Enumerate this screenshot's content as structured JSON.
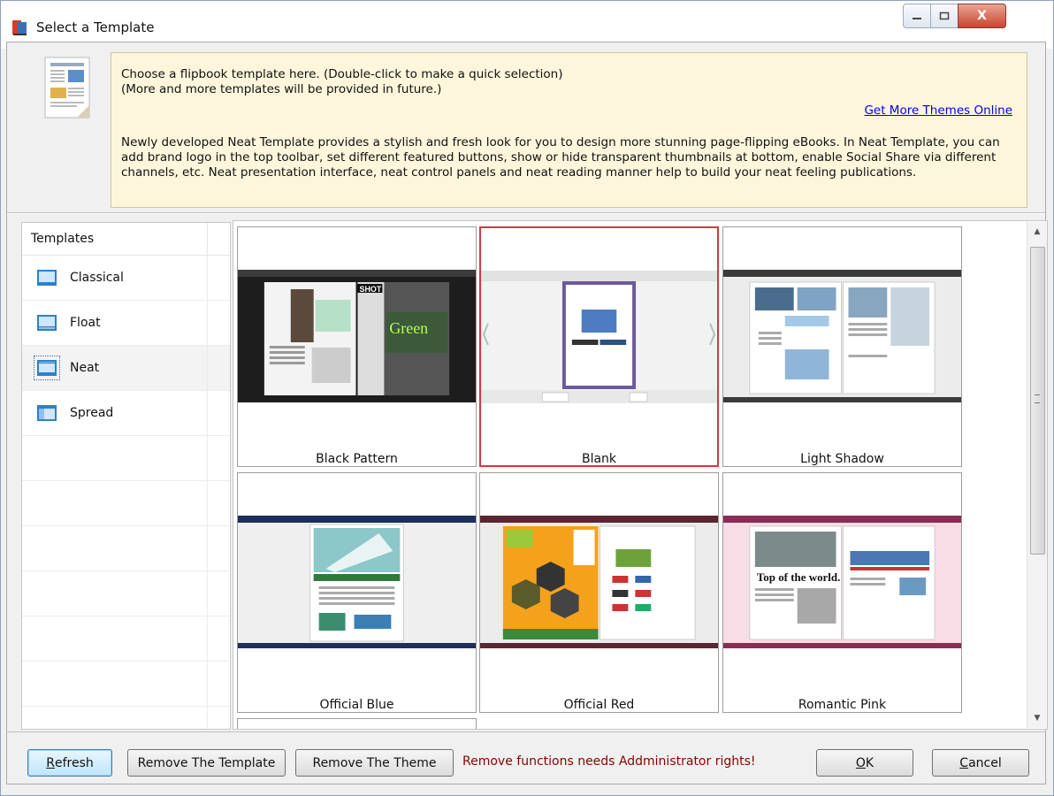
{
  "window": {
    "title": "Select a Template",
    "controls": {
      "minimize": "minimize-icon",
      "maximize": "maximize-icon",
      "close": "X"
    }
  },
  "info": {
    "line1": "Choose a flipbook template here. (Double-click to make a quick selection)",
    "line2": "(More and more templates will be provided in future.)",
    "link": "Get More Themes Online",
    "description": "Newly developed Neat Template provides a stylish and fresh look for you to design more stunning page-flipping eBooks. In Neat Template, you can add brand logo in the top toolbar, set different featured buttons, show or hide transparent thumbnails at bottom, enable Social Share via different channels, etc. Neat presentation interface, neat control panels and neat reading manner help to build your neat feeling publications."
  },
  "sidebar": {
    "header": "Templates",
    "items": [
      {
        "label": "Classical",
        "icon": "classical-template-icon"
      },
      {
        "label": "Float",
        "icon": "float-template-icon"
      },
      {
        "label": "Neat",
        "icon": "neat-template-icon",
        "selected": true
      },
      {
        "label": "Spread",
        "icon": "spread-template-icon"
      }
    ]
  },
  "gallery": {
    "selected": "Blank",
    "themes": [
      {
        "label": "Black Pattern",
        "accent": "#2b2b2b"
      },
      {
        "label": "Blank",
        "accent": "#e6e6e6"
      },
      {
        "label": "Light Shadow",
        "accent": "#3a3a3a"
      },
      {
        "label": "Official Blue",
        "accent": "#1c2e5a"
      },
      {
        "label": "Official Red",
        "accent": "#5a2633"
      },
      {
        "label": "Romantic Pink",
        "accent": "#8a2c55"
      }
    ]
  },
  "buttons": {
    "refresh_hotkey": "R",
    "refresh_rest": "efresh",
    "remove_template": "Remove The Template",
    "remove_theme": "Remove The Theme",
    "ok_hotkey": "O",
    "ok_rest": "K",
    "cancel_hotkey": "C",
    "cancel_rest": "ancel"
  },
  "warning": "Remove functions needs Addministrator rights!",
  "colors": {
    "warning": "#8b0000",
    "selection": "#d9363e",
    "info_bg": "#fdf6dc",
    "link": "#0000ee"
  }
}
